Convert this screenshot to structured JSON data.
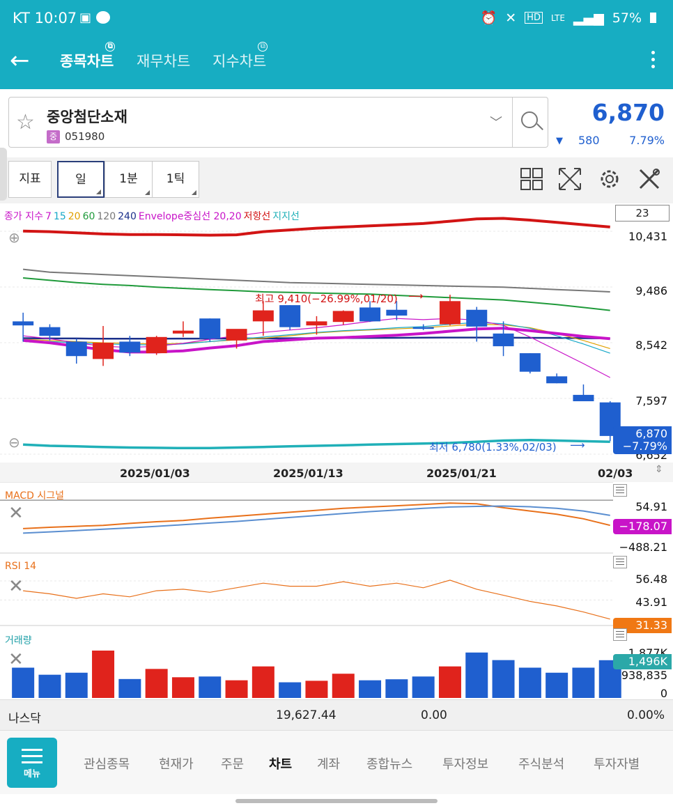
{
  "status_bar": {
    "carrier_time": "KT 10:07",
    "battery": "57%",
    "network": "LTE"
  },
  "header": {
    "tabs": [
      {
        "label": "종목차트",
        "active": true
      },
      {
        "label": "재무차트",
        "active": false
      },
      {
        "label": "지수차트",
        "active": false
      }
    ]
  },
  "stock": {
    "name": "중앙첨단소재",
    "badge": "중",
    "code": "051980",
    "price": "6,870",
    "change": "580",
    "change_pct": "7.79%",
    "change_dir_icon": "down-triangle-icon"
  },
  "toolbar": {
    "indicator_label": "지표",
    "period_label": "일",
    "minute_label": "1분",
    "tick_label": "1틱"
  },
  "colors": {
    "up": "#e0231c",
    "down": "#1f5fcf",
    "accent": "#17adc2",
    "envelope": "#c814c8",
    "resistance": "#d21414",
    "support": "#20b0b8"
  },
  "main_chart": {
    "legend": [
      {
        "text": "종가 지수",
        "color": "#c814c8"
      },
      {
        "text": "7",
        "color": "#c814c8"
      },
      {
        "text": "15",
        "color": "#17a8c8"
      },
      {
        "text": "20",
        "color": "#e0a000"
      },
      {
        "text": "60",
        "color": "#1f9a3a"
      },
      {
        "text": "120",
        "color": "#777777"
      },
      {
        "text": "240",
        "color": "#1a2f8a"
      },
      {
        "text": "Envelope중심선 20,20",
        "color": "#c814c8"
      },
      {
        "text": "저항선",
        "color": "#d21414"
      },
      {
        "text": "지지선",
        "color": "#20b0b8"
      }
    ],
    "visible_count": "23",
    "y_ticks": [
      "10,431",
      "9,486",
      "8,542",
      "7,597",
      "6,652"
    ],
    "x_ticks": [
      "2025/01/03",
      "2025/01/13",
      "2025/01/21",
      "02/03"
    ],
    "high_annotation": "최고 9,410(−26.99%,01/20)",
    "low_annotation": "최저 6,780(1.33%,02/03)",
    "last_price_label": "6,870",
    "last_change_label": "−7.79%"
  },
  "chart_data": [
    {
      "type": "candlestick",
      "ylim": [
        6652,
        10800
      ],
      "candles": [
        {
          "o": 8850,
          "h": 9000,
          "l": 8500,
          "c": 8780
        },
        {
          "o": 8750,
          "h": 8800,
          "l": 8520,
          "c": 8600
        },
        {
          "o": 8500,
          "h": 8550,
          "l": 8120,
          "c": 8250
        },
        {
          "o": 8200,
          "h": 8770,
          "l": 8080,
          "c": 8480
        },
        {
          "o": 8500,
          "h": 8600,
          "l": 8250,
          "c": 8310
        },
        {
          "o": 8300,
          "h": 8600,
          "l": 8270,
          "c": 8580
        },
        {
          "o": 8640,
          "h": 8850,
          "l": 8580,
          "c": 8690
        },
        {
          "o": 8900,
          "h": 8900,
          "l": 8500,
          "c": 8550
        },
        {
          "o": 8520,
          "h": 8700,
          "l": 8380,
          "c": 8720
        },
        {
          "o": 8850,
          "h": 9200,
          "l": 8600,
          "c": 9040
        },
        {
          "o": 9130,
          "h": 9130,
          "l": 8700,
          "c": 8750
        },
        {
          "o": 8780,
          "h": 8940,
          "l": 8620,
          "c": 8850
        },
        {
          "o": 8840,
          "h": 9040,
          "l": 8790,
          "c": 9030
        },
        {
          "o": 9090,
          "h": 9200,
          "l": 8840,
          "c": 8850
        },
        {
          "o": 9050,
          "h": 9200,
          "l": 8870,
          "c": 8950
        },
        {
          "o": 8750,
          "h": 8800,
          "l": 8700,
          "c": 8720
        },
        {
          "o": 8800,
          "h": 9310,
          "l": 8780,
          "c": 9200
        },
        {
          "o": 9050,
          "h": 9100,
          "l": 8500,
          "c": 8760
        },
        {
          "o": 8640,
          "h": 8850,
          "l": 8250,
          "c": 8420
        },
        {
          "o": 8300,
          "h": 8300,
          "l": 7950,
          "c": 7980
        },
        {
          "o": 7900,
          "h": 7950,
          "l": 7780,
          "c": 7780
        },
        {
          "o": 7580,
          "h": 7760,
          "l": 7480,
          "c": 7470
        },
        {
          "o": 7450,
          "h": 7470,
          "l": 6780,
          "c": 6870
        }
      ],
      "lines": {
        "resistance": [
          10410,
          10400,
          10380,
          10360,
          10350,
          10350,
          10345,
          10340,
          10345,
          10400,
          10430,
          10460,
          10480,
          10500,
          10520,
          10540,
          10580,
          10620,
          10630,
          10600,
          10560,
          10520,
          10480
        ],
        "ma120": [
          9750,
          9700,
          9680,
          9660,
          9640,
          9620,
          9600,
          9580,
          9560,
          9540,
          9520,
          9510,
          9500,
          9490,
          9480,
          9470,
          9460,
          9450,
          9440,
          9420,
          9400,
          9380,
          9360
        ],
        "ma60": [
          9600,
          9560,
          9520,
          9490,
          9470,
          9440,
          9420,
          9400,
          9380,
          9360,
          9350,
          9340,
          9330,
          9320,
          9300,
          9280,
          9260,
          9240,
          9220,
          9180,
          9140,
          9090,
          9040
        ],
        "ma240": [
          8560,
          8555,
          8555,
          8550,
          8550,
          8550,
          8552,
          8552,
          8555,
          8555,
          8558,
          8560,
          8562,
          8564,
          8566,
          8568,
          8570,
          8570,
          8568,
          8566,
          8564,
          8560,
          8555
        ],
        "envelope_mid": [
          8520,
          8480,
          8420,
          8360,
          8320,
          8320,
          8340,
          8390,
          8430,
          8500,
          8530,
          8560,
          8570,
          8590,
          8610,
          8640,
          8680,
          8720,
          8730,
          8690,
          8640,
          8590,
          8550
        ],
        "ma20": [
          8540,
          8520,
          8500,
          8480,
          8470,
          8460,
          8470,
          8500,
          8530,
          8560,
          8600,
          8650,
          8680,
          8700,
          8720,
          8740,
          8770,
          8800,
          8790,
          8740,
          8640,
          8520,
          8380
        ],
        "ma15": [
          8520,
          8500,
          8480,
          8460,
          8450,
          8440,
          8460,
          8500,
          8540,
          8580,
          8620,
          8660,
          8690,
          8710,
          8740,
          8760,
          8800,
          8830,
          8810,
          8730,
          8600,
          8460,
          8300
        ],
        "ma7": [
          8600,
          8550,
          8480,
          8420,
          8400,
          8420,
          8470,
          8540,
          8600,
          8660,
          8700,
          8740,
          8790,
          8850,
          8900,
          8880,
          8900,
          8870,
          8780,
          8580,
          8350,
          8120,
          7880
        ],
        "support": [
          6720,
          6700,
          6690,
          6680,
          6670,
          6665,
          6660,
          6660,
          6670,
          6680,
          6690,
          6700,
          6710,
          6720,
          6730,
          6740,
          6750,
          6770,
          6790,
          6800,
          6790,
          6780,
          6770
        ]
      }
    },
    {
      "type": "line",
      "title": "MACD 시그널",
      "y_ticks": [
        "54.91",
        "−488.21"
      ],
      "last_label": "−178.07",
      "ylim": [
        -520,
        120
      ],
      "series": [
        {
          "name": "MACD",
          "color": "#e8701a",
          "values": [
            -380,
            -360,
            -345,
            -330,
            -300,
            -275,
            -255,
            -220,
            -190,
            -160,
            -130,
            -100,
            -70,
            -50,
            -30,
            -10,
            10,
            0,
            -60,
            -110,
            -160,
            -230,
            -330
          ]
        },
        {
          "name": "시그널",
          "color": "#5a8ed0",
          "values": [
            -450,
            -430,
            -410,
            -390,
            -370,
            -345,
            -320,
            -295,
            -270,
            -240,
            -210,
            -180,
            -150,
            -120,
            -95,
            -70,
            -50,
            -40,
            -35,
            -45,
            -70,
            -110,
            -178
          ]
        }
      ],
      "zero_line": 0
    },
    {
      "type": "line",
      "title": "RSI 14",
      "y_ticks": [
        "56.48",
        "43.91",
        "31.33"
      ],
      "last_label": "31.33",
      "ylim": [
        28,
        62
      ],
      "series": [
        {
          "name": "RSI 14",
          "color": "#e8701a",
          "values": [
            50,
            48,
            45,
            48,
            46,
            50,
            51,
            49,
            52,
            55,
            53,
            53,
            56,
            53,
            55,
            52,
            57,
            51,
            47,
            43,
            40,
            36,
            31.33
          ]
        }
      ]
    },
    {
      "type": "bar",
      "title": "거래량",
      "y_ticks": [
        "1,877K",
        "938,835",
        "0"
      ],
      "last_label": "1,496K",
      "ylim": [
        0,
        1877000
      ],
      "values": [
        1200000,
        920000,
        1000000,
        1877000,
        750000,
        1150000,
        820000,
        850000,
        700000,
        1250000,
        620000,
        680000,
        960000,
        700000,
        740000,
        850000,
        1250000,
        1800000,
        1500000,
        1200000,
        1000000,
        1200000,
        1496000
      ],
      "up": [
        false,
        false,
        false,
        true,
        false,
        true,
        true,
        false,
        true,
        true,
        false,
        true,
        true,
        false,
        false,
        false,
        true,
        false,
        false,
        false,
        false,
        false,
        false
      ]
    }
  ],
  "index_row": {
    "name": "나스닥",
    "value": "19,627.44",
    "change": "0.00",
    "change_pct": "0.00%"
  },
  "bottom_nav": {
    "menu_label": "메뉴",
    "items": [
      {
        "label": "관심종목",
        "active": false
      },
      {
        "label": "현재가",
        "active": false
      },
      {
        "label": "주문",
        "active": false
      },
      {
        "label": "차트",
        "active": true
      },
      {
        "label": "계좌",
        "active": false
      },
      {
        "label": "종합뉴스",
        "active": false
      },
      {
        "label": "투자정보",
        "active": false
      },
      {
        "label": "주식분석",
        "active": false
      },
      {
        "label": "투자자별",
        "active": false
      }
    ]
  }
}
